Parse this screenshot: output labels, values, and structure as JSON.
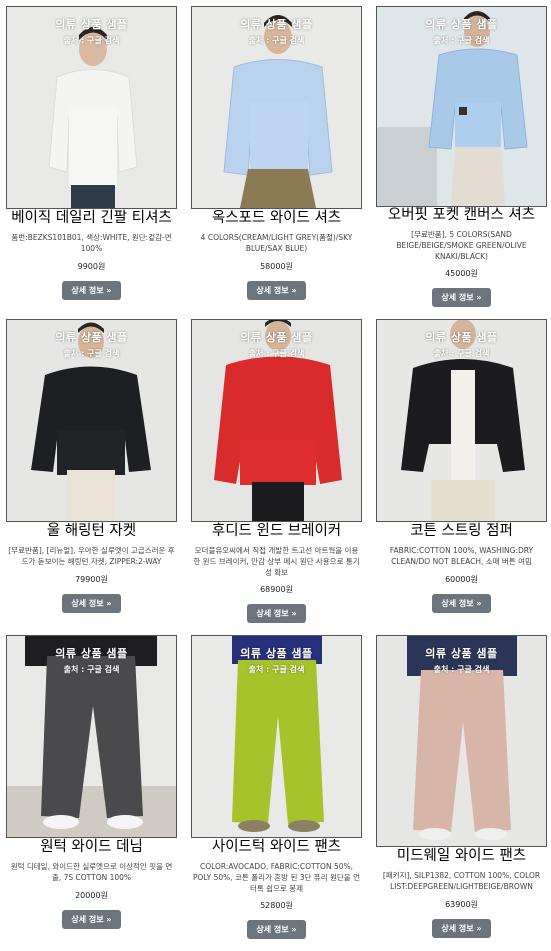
{
  "overlay": {
    "line1": "의류 상품 샘플",
    "line2": "출처 : 구글 검색"
  },
  "button_label": "상세 정보 »",
  "products": [
    {
      "title": "베이직 데일리 긴팔 티셔츠",
      "desc": "품번:BEZKS101B01, 색상:WHITE, 원단:겉감-면 100%",
      "price": "9900원"
    },
    {
      "title": "옥스포드 와이드 셔츠",
      "desc": "4 COLORS(CREAM/LIGHT GREY(품절)/SKY BLUE/SAX BLUE)",
      "price": "58000원"
    },
    {
      "title": "오버핏 포켓 캔버스 셔츠",
      "desc": "[무료반품], 5 COLORS(SAND BEIGE/BEIGE/SMOKE GREEN/OLIVE KNAKI/BLACK)",
      "price": "45000원"
    },
    {
      "title": "울 해링턴 자켓",
      "desc": "[무료반품], [리뉴얼], 우아한 실루엣이 고급스러운 후드가 돋보이는 해링턴 자켓, ZIPPER:2-WAY",
      "price": "79900원"
    },
    {
      "title": "후디드 윈드 브레이커",
      "desc": "모더블유오씨에서 직접 개발한 트고선 아트웍을 이용한 윈드 브레이커, 안감 상부 메시 원단 사용으로 통기성 확보",
      "price": "68900원"
    },
    {
      "title": "코튼 스트링 점퍼",
      "desc": "FABRIC:COTTON 100%, WASHING:DRY CLEAN/DO NOT BLEACH, 소매 버튼 여밈",
      "price": "60000원"
    },
    {
      "title": "원턱 와이드 데님",
      "desc": "원턱 디테일, 와이드한 실루엣으로 이상적인 핏을 연출, 7S COTTON 100%",
      "price": "20000원"
    },
    {
      "title": "사이드턱 와이드 팬츠",
      "desc": "COLOR:AVOCADO, FABRIC:COTTON 50%, POLY 50%, 코튼 폴리가 혼방 된 3단 퓨리 원단을 언터록 쉽으로 봉제",
      "price": "52800원"
    },
    {
      "title": "미드웨일 와이드 팬츠",
      "desc": "[패키지], SILP1382, COTTON 100%, COLOR LIST:DEEPGREEN/LIGHTBEIGE/BROWN",
      "price": "63900원"
    }
  ],
  "colors": {
    "button": "#6c757d",
    "border": "#555555"
  }
}
